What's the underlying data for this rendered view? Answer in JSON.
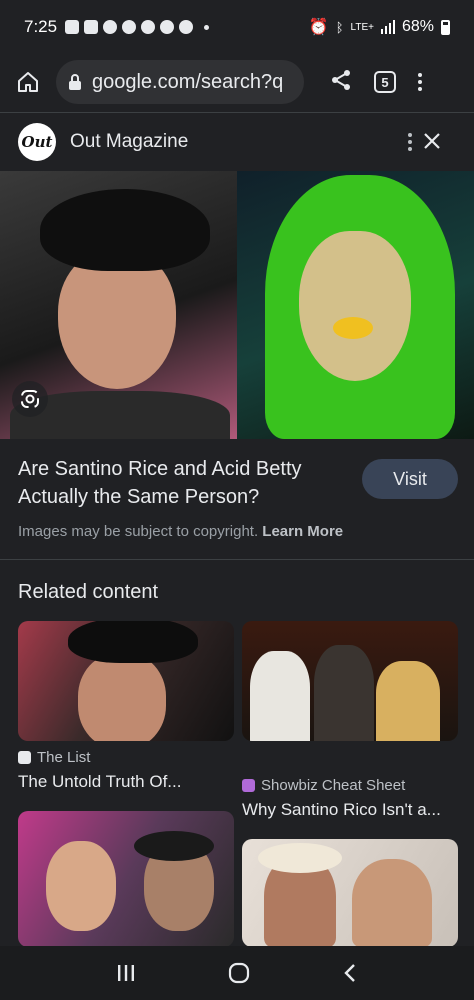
{
  "status_bar": {
    "time": "7:25",
    "network": "LTE+",
    "battery": "68%"
  },
  "browser": {
    "url": "google.com/search?q",
    "tab_count": "5"
  },
  "source": {
    "logo_text": "Out",
    "name": "Out Magazine"
  },
  "result": {
    "title": "Are Santino Rice and Acid Betty Actually the Same Person?",
    "visit_label": "Visit",
    "copyright_text": "Images may be subject to copyright.",
    "learn_more": "Learn More"
  },
  "related": {
    "heading": "Related content",
    "cards": [
      {
        "source": "The List",
        "title": "The Untold Truth Of..."
      },
      {
        "source": "Showbiz Cheat Sheet",
        "title": "Why Santino Rico Isn't a..."
      },
      {
        "source": "",
        "title": ""
      },
      {
        "source": "",
        "title": ""
      }
    ]
  },
  "colors": {
    "background": "#202124",
    "visit_button": "#394457",
    "text": "#e8eaed",
    "muted": "#9aa0a6"
  }
}
